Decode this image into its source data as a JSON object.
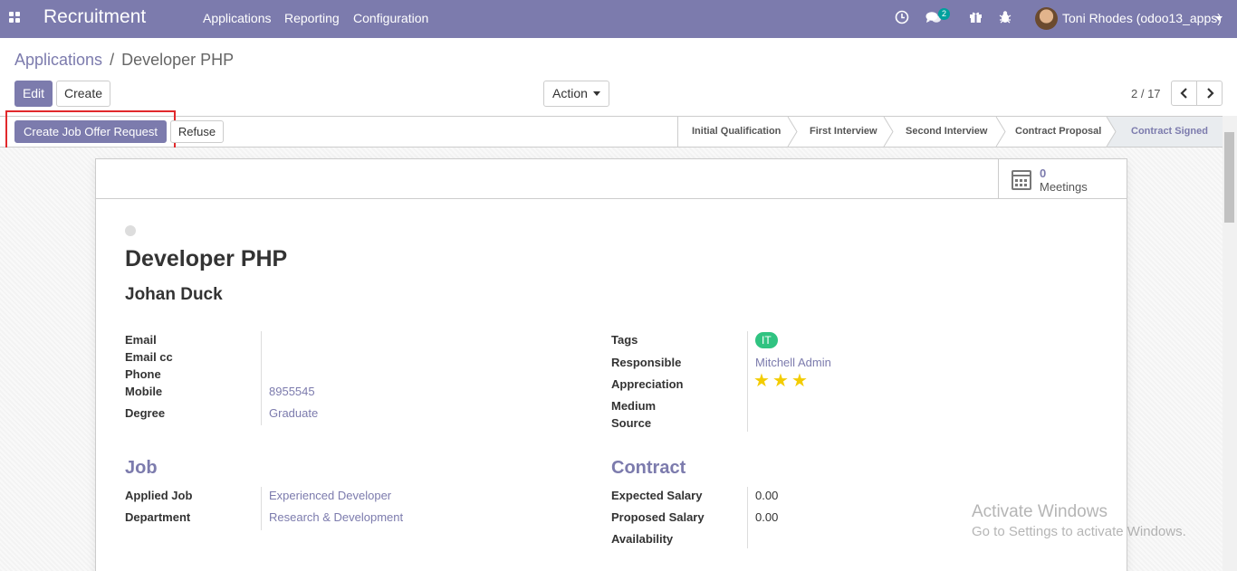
{
  "navbar": {
    "brand": "Recruitment",
    "menus": [
      "Applications",
      "Reporting",
      "Configuration"
    ],
    "messages_badge": "2",
    "user": "Toni Rhodes (odoo13_apps)"
  },
  "breadcrumb": {
    "parent": "Applications",
    "separator": "/",
    "current": "Developer PHP"
  },
  "buttons": {
    "edit": "Edit",
    "create": "Create",
    "action": "Action",
    "create_offer": "Create Job Offer Request",
    "refuse": "Refuse"
  },
  "pager": {
    "value": "2 / 17"
  },
  "stages": [
    "Initial Qualification",
    "First Interview",
    "Second Interview",
    "Contract Proposal",
    "Contract Signed"
  ],
  "meetings": {
    "count": "0",
    "label": "Meetings"
  },
  "record": {
    "title": "Developer PHP",
    "name": "Johan Duck",
    "left_fields": [
      {
        "label": "Email",
        "value": ""
      },
      {
        "label": "Email cc",
        "value": ""
      },
      {
        "label": "Phone",
        "value": ""
      },
      {
        "label": "Mobile",
        "value": "8955545"
      },
      {
        "label": "Degree",
        "value": "Graduate"
      }
    ],
    "right_fields": [
      {
        "label": "Tags",
        "value": "IT"
      },
      {
        "label": "Responsible",
        "value": "Mitchell Admin"
      },
      {
        "label": "Appreciation",
        "value": 3,
        "max": 3
      },
      {
        "label": "Medium",
        "value": ""
      },
      {
        "label": "Source",
        "value": ""
      }
    ]
  },
  "job_section": {
    "title": "Job",
    "fields": [
      {
        "label": "Applied Job",
        "value": "Experienced Developer"
      },
      {
        "label": "Department",
        "value": "Research & Development"
      }
    ]
  },
  "contract_section": {
    "title": "Contract",
    "fields": [
      {
        "label": "Expected Salary",
        "value": "0.00"
      },
      {
        "label": "Proposed Salary",
        "value": "0.00"
      },
      {
        "label": "Availability",
        "value": ""
      }
    ]
  },
  "watermark": {
    "line1": "Activate Windows",
    "line2": "Go to Settings to activate Windows."
  },
  "colors": {
    "brand": "#7c7bad",
    "tag_green": "#30c381",
    "star": "#f3cc00",
    "highlight": "#e1292c"
  }
}
